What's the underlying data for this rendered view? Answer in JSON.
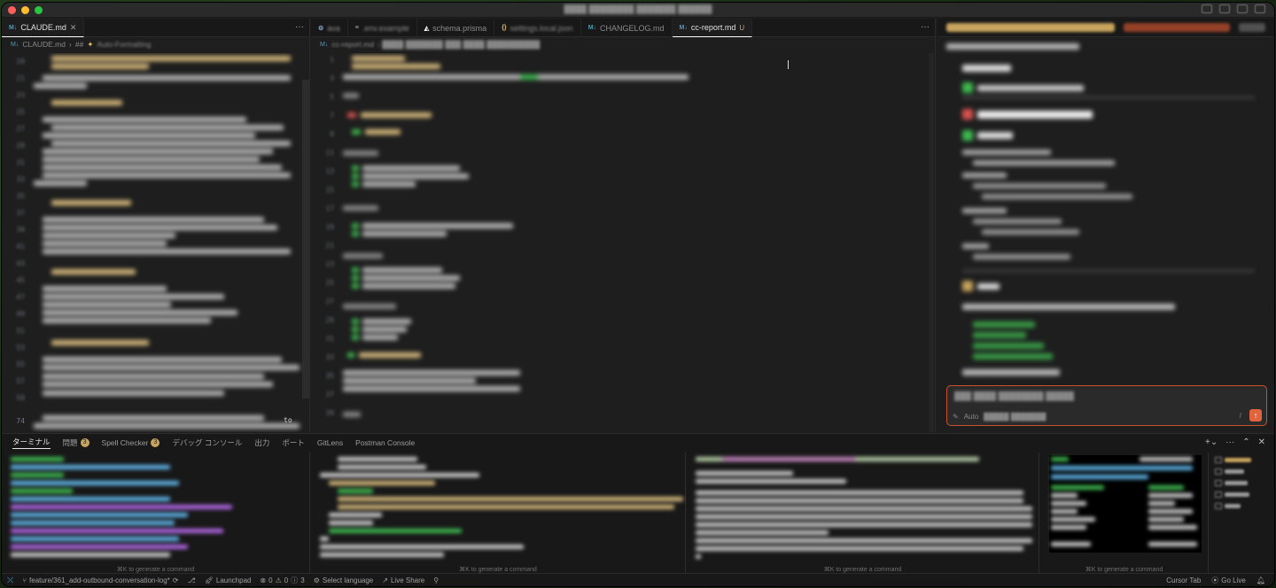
{
  "editor_group_left": {
    "tabs": [
      {
        "label": "CLAUDE.md",
        "active": true
      }
    ],
    "breadcrumb": [
      "CLAUDE.md",
      "##",
      "Auto-Formatting"
    ],
    "line_numbers": [
      "74"
    ],
    "text_fragment": "to"
  },
  "editor_group_center": {
    "tabs": [
      {
        "label": "ava",
        "icon": "gear-icon"
      },
      {
        "label": ".env.example",
        "icon": "equals-icon"
      },
      {
        "label": "schema.prisma",
        "icon": "prisma-icon"
      },
      {
        "label": "settings.local.json",
        "icon": "json-icon"
      },
      {
        "label": "CHANGELOG.md",
        "icon": "markdown-icon"
      },
      {
        "label": "cc-report.md",
        "icon": "markdown-icon",
        "active": true,
        "status": "U"
      }
    ],
    "breadcrumb": [
      "cc-report.md"
    ]
  },
  "chat": {
    "input_footer": "Auto",
    "slash": "/",
    "send_icon": "↑"
  },
  "panel": {
    "tabs": [
      {
        "label": "ターミナル",
        "active": true
      },
      {
        "label": "問題",
        "badge": "3"
      },
      {
        "label": "Spell Checker",
        "badge": "3"
      },
      {
        "label": "デバッグ コンソール"
      },
      {
        "label": "出力"
      },
      {
        "label": "ポート"
      },
      {
        "label": "GitLens"
      },
      {
        "label": "Postman Console"
      }
    ],
    "hint": "⌘K to generate a command"
  },
  "statusbar": {
    "branch": "feature/361_add-outbound-conversation-log*",
    "launchpad": "Launchpad",
    "errors": "0",
    "warnings": "0",
    "info": "3",
    "select_language": "Select language",
    "live_share": "Live Share",
    "cursor_tab": "Cursor Tab",
    "go_live": "Go Live"
  },
  "colors": {
    "accent_orange": "#e0643e",
    "badge_yellow": "#c8a45c",
    "remote_blue": "#4fc1ff"
  }
}
